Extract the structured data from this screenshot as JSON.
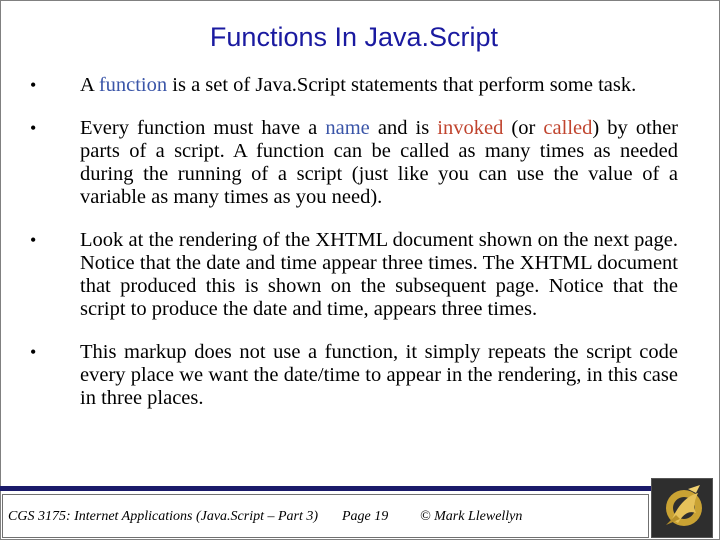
{
  "title": "Functions In Java.Script",
  "bullets": [
    {
      "marker": "•",
      "parts": [
        {
          "text": "A ",
          "style": "normal"
        },
        {
          "text": "function",
          "style": "blue"
        },
        {
          "text": " is a set of Java.Script statements that perform some task.",
          "style": "normal"
        }
      ]
    },
    {
      "marker": "•",
      "parts": [
        {
          "text": "Every function must have a ",
          "style": "normal"
        },
        {
          "text": "name",
          "style": "blue"
        },
        {
          "text": " and is ",
          "style": "normal"
        },
        {
          "text": "invoked",
          "style": "red"
        },
        {
          "text": " (or ",
          "style": "normal"
        },
        {
          "text": "called",
          "style": "red"
        },
        {
          "text": ") by other parts of a script.  A function can be called as many times as needed during the running of a script (just like you can use the value of a variable as many times as you need).",
          "style": "normal"
        }
      ]
    },
    {
      "marker": "•",
      "parts": [
        {
          "text": "Look at the rendering of the XHTML document shown on the next page.  Notice that the date and time appear three times.  The XHTML document that produced this is shown on the subsequent page.  Notice that the script to produce the date and time, appears three times.",
          "style": "normal"
        }
      ]
    },
    {
      "marker": "•",
      "parts": [
        {
          "text": "This markup does not use a function, it simply repeats the script code every place we want the date/time to appear in the rendering, in this case in three places.",
          "style": "normal"
        }
      ]
    }
  ],
  "footer": {
    "course": "CGS 3175: Internet Applications (Java.Script – Part 3)",
    "page": "Page 19",
    "author": "© Mark Llewellyn"
  },
  "colors": {
    "title": "#1a1aa0",
    "highlight_blue": "#3a55a8",
    "highlight_red": "#c0442e",
    "footer_rule": "#1a1a6a"
  },
  "logo_icon": "ucf-pegasus-logo-icon"
}
